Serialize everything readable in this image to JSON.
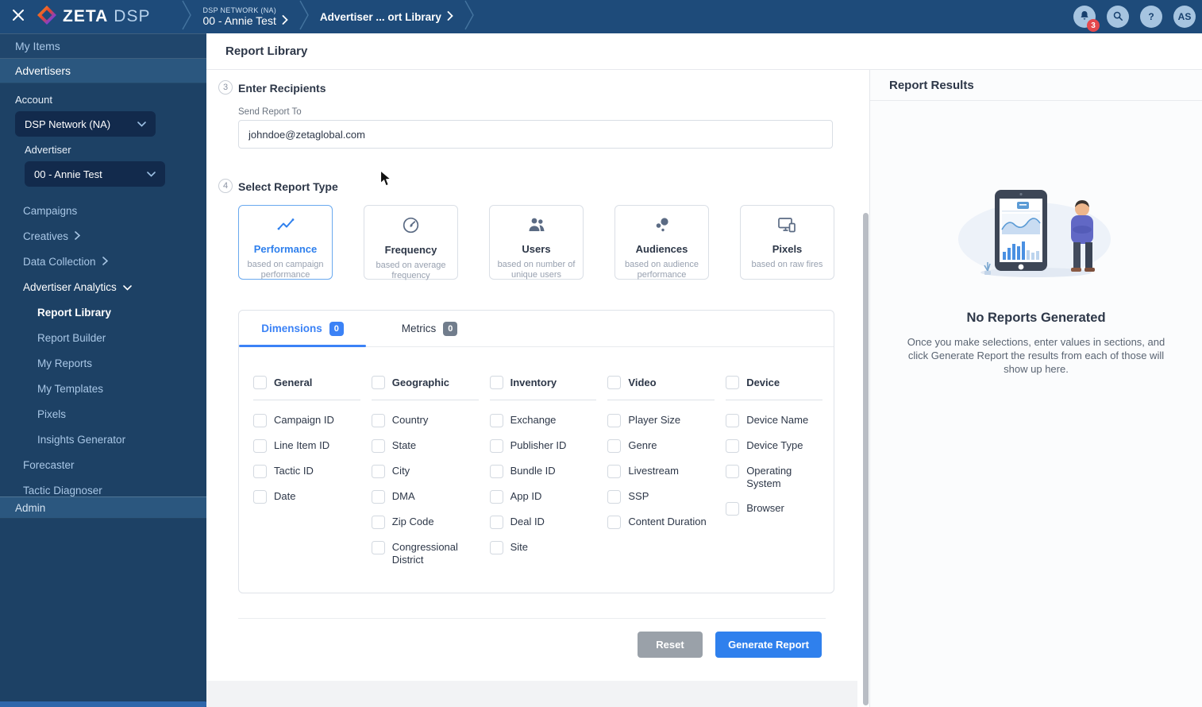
{
  "colors": {
    "accent": "#2f80ed",
    "topbar": "#1e4b7a",
    "sidebar": "#1d4165",
    "badge_red": "#e5484d"
  },
  "topbar": {
    "brand_primary": "ZETA",
    "brand_secondary": "DSP",
    "breadcrumb": {
      "network_small": "DSP NETWORK (NA)",
      "network_value": "00 - Annie Test",
      "page": "Advertiser ... ort Library"
    },
    "notification_count": "3",
    "help_label": "?",
    "avatar_initials": "AS"
  },
  "sidebar": {
    "my_items": "My Items",
    "section_advertisers": "Advertisers",
    "account": {
      "label": "Account",
      "value": "DSP Network (NA)"
    },
    "advertiser": {
      "label": "Advertiser",
      "value": "00 - Annie Test"
    },
    "nav": {
      "campaigns": "Campaigns",
      "creatives": "Creatives",
      "data_collection": "Data Collection",
      "advertiser_analytics": "Advertiser Analytics",
      "report_library": "Report Library",
      "report_builder": "Report Builder",
      "my_reports": "My Reports",
      "my_templates": "My Templates",
      "pixels": "Pixels",
      "insights_generator": "Insights Generator",
      "forecaster": "Forecaster",
      "tactic_diagnoser": "Tactic Diagnoser"
    },
    "section_admin": "Admin"
  },
  "main": {
    "page_title": "Report Library",
    "recipients": {
      "step": "3",
      "title": "Enter Recipients",
      "field_label": "Send Report To",
      "field_value": "johndoe@zetaglobal.com"
    },
    "report_type": {
      "step": "4",
      "title": "Select Report Type",
      "cards": [
        {
          "label": "Performance",
          "desc": "based on campaign performance"
        },
        {
          "label": "Frequency",
          "desc": "based on average frequency"
        },
        {
          "label": "Users",
          "desc": "based on number of unique users"
        },
        {
          "label": "Audiences",
          "desc": "based on audience performance"
        },
        {
          "label": "Pixels",
          "desc": "based on raw fires"
        }
      ]
    },
    "tabs": {
      "dimensions_label": "Dimensions",
      "dimensions_count": "0",
      "metrics_label": "Metrics",
      "metrics_count": "0"
    },
    "dimension_groups": [
      {
        "label": "General",
        "items": [
          "Campaign ID",
          "Line Item ID",
          "Tactic ID",
          "Date"
        ]
      },
      {
        "label": "Geographic",
        "items": [
          "Country",
          "State",
          "City",
          "DMA",
          "Zip Code",
          "Congressional District"
        ]
      },
      {
        "label": "Inventory",
        "items": [
          "Exchange",
          "Publisher ID",
          "Bundle ID",
          "App ID",
          "Deal ID",
          "Site"
        ]
      },
      {
        "label": "Video",
        "items": [
          "Player Size",
          "Genre",
          "Livestream",
          "SSP",
          "Content Duration"
        ]
      },
      {
        "label": "Device",
        "items": [
          "Device Name",
          "Device Type",
          "Operating System",
          "Browser"
        ]
      }
    ],
    "actions": {
      "reset": "Reset",
      "generate": "Generate Report"
    }
  },
  "results": {
    "title": "Report Results",
    "empty_title": "No Reports Generated",
    "empty_text": "Once you make selections, enter values in sections, and click Generate Report the results from each of those will show up here."
  }
}
